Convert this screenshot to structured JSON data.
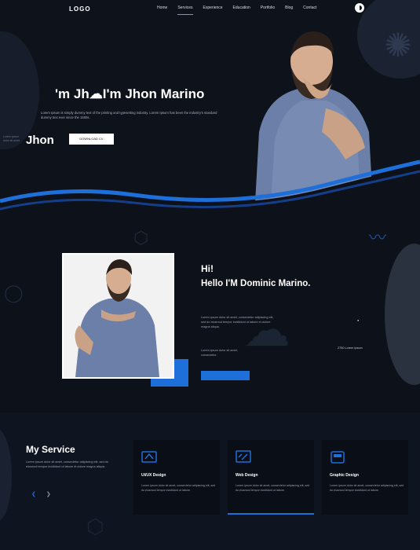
{
  "nav": {
    "logo": "LOGO",
    "links": [
      "Home",
      "Services",
      "Experience",
      "Education",
      "Portfolio",
      "Blog",
      "Contact"
    ],
    "active_index": 1
  },
  "hero": {
    "title": "'m Jh☁I'm Jhon Marino",
    "description": "Lorem Ipsum is simply dummy text of the printing and typesetting industry. Lorem Ipsum has been the industry's standard dummy text ever since the 1500s.",
    "side_note": "Lorem ipsum dolor sit amet",
    "name_word": "Jhon",
    "button_label": "DOWNLOAD CV"
  },
  "about": {
    "hi": "Hi!",
    "heading": "Hello I'M Dominic Marino.",
    "text": "Lorem ipsum dolor sit amet, consectetur adipiscing elit, sed do eiusmod tempor incididunt ut labore et dolore magna aliqua.",
    "small_text": "Lorem ipsum dolor sit amet, consectetur.",
    "stat_text": "2750 Lorem Ipsum"
  },
  "services": {
    "title": "My Service",
    "description": "Lorem ipsum dolor sit amet, consectetur adipiscing elit, sed do eiusmod tempor incididunt ut labore et dolore magna aliqua.",
    "cards": [
      {
        "name": "Ui/UX Design",
        "text": "Lorem ipsum dolor sit amet, consectetur adipiscing elit, sed do eiusmod tempor incididunt ut labore."
      },
      {
        "name": "Web Design",
        "text": "Lorem ipsum dolor sit amet, consectetur adipiscing elit, sed do eiusmod tempor incididunt ut labore."
      },
      {
        "name": "Graphic Design",
        "text": "Lorem ipsum dolor sit amet, consectetur adipiscing elit, sed do eiusmod tempor incididunt ut labore."
      }
    ],
    "active_card": 1
  },
  "colors": {
    "accent": "#1e6fd9",
    "background": "#0b0f17"
  }
}
